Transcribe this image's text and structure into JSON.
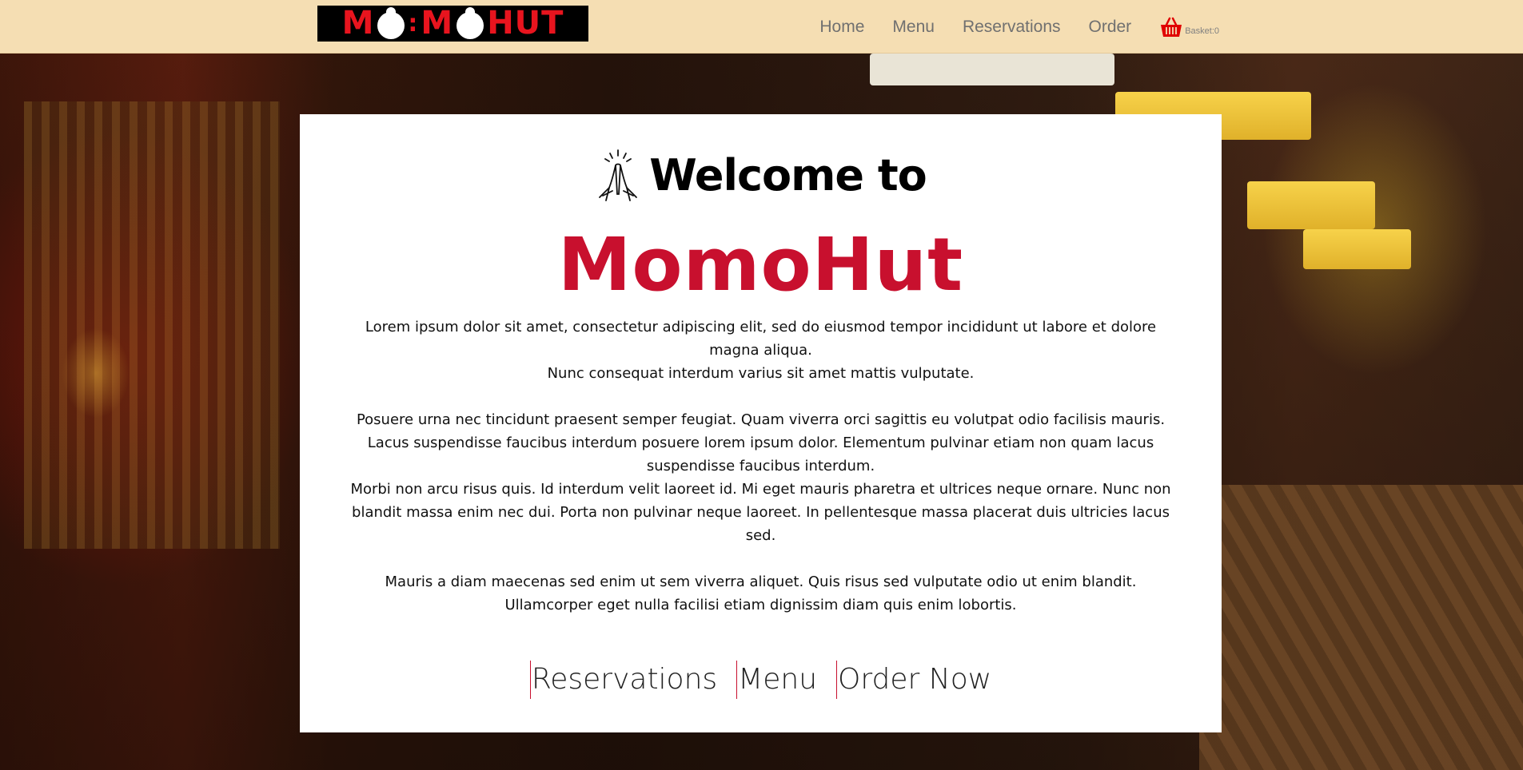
{
  "header": {
    "logo_text": "MOMOHUT",
    "logo_parts": [
      "M",
      "M",
      "HUT"
    ],
    "nav": [
      "Home",
      "Menu",
      "Reservations",
      "Order"
    ],
    "basket_label": "Basket:0"
  },
  "hero": {
    "welcome": "Welcome to",
    "brand": "MomoHut",
    "paragraphs": [
      "Lorem ipsum dolor sit amet, consectetur adipiscing elit, sed do eiusmod tempor incididunt ut labore et dolore magna aliqua.",
      "Nunc consequat interdum varius sit amet mattis vulputate.",
      "",
      "Posuere urna nec tincidunt praesent semper feugiat. Quam viverra orci sagittis eu volutpat odio facilisis mauris.",
      "Lacus suspendisse faucibus interdum posuere lorem ipsum dolor. Elementum pulvinar etiam non quam lacus suspendisse faucibus interdum.",
      "Morbi non arcu risus quis. Id interdum velit laoreet id. Mi eget mauris pharetra et ultrices neque ornare. Nunc non blandit massa enim nec dui. Porta non pulvinar neque laoreet. In pellentesque massa placerat duis ultricies lacus sed.",
      "",
      "Mauris a diam maecenas sed enim ut sem viverra aliquet. Quis risus sed vulputate odio ut enim blandit. Ullamcorper eget nulla facilisi etiam dignissim diam quis enim lobortis."
    ],
    "cta": [
      "Reservations",
      "Menu",
      "Order Now"
    ]
  },
  "colors": {
    "header_bg": "#f5deb3",
    "brand_red": "#c8102e",
    "nav_text": "#707070",
    "logo_red": "#e8141e"
  },
  "icons": {
    "logo_buns": "momo-dumpling-icon",
    "welcome": "praying-hands-icon",
    "basket": "shopping-basket-icon"
  }
}
